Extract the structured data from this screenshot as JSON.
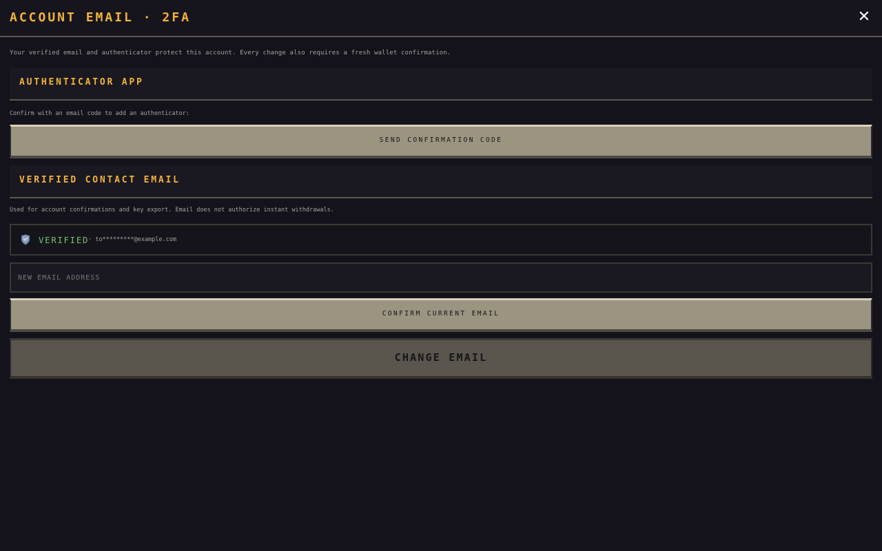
{
  "header": {
    "title": "ACCOUNT EMAIL · 2FA",
    "close_icon": "✕"
  },
  "intro": "Your verified email and authenticator protect this account. Every change also requires a fresh wallet confirmation.",
  "authenticator": {
    "title": "AUTHENTICATOR APP",
    "helper": "Confirm with an email code to add an authenticator:",
    "send_code_label": "SEND CONFIRMATION CODE"
  },
  "contact_email": {
    "title": "VERIFIED CONTACT EMAIL",
    "helper": "Used for account confirmations and key export. Email does not authorize instant withdrawals.",
    "status_icon": "shield-icon",
    "status_label": "VERIFIED",
    "masked_email": "· to*********@example.com",
    "new_email_placeholder": "NEW EMAIL ADDRESS",
    "new_email_value": "",
    "confirm_label": "CONFIRM CURRENT EMAIL",
    "change_label": "CHANGE EMAIL"
  },
  "colors": {
    "accent": "#f2b33e",
    "verified": "#74c277",
    "background": "#14131c",
    "button_primary": "#9a9480",
    "button_secondary": "#5a554d"
  }
}
